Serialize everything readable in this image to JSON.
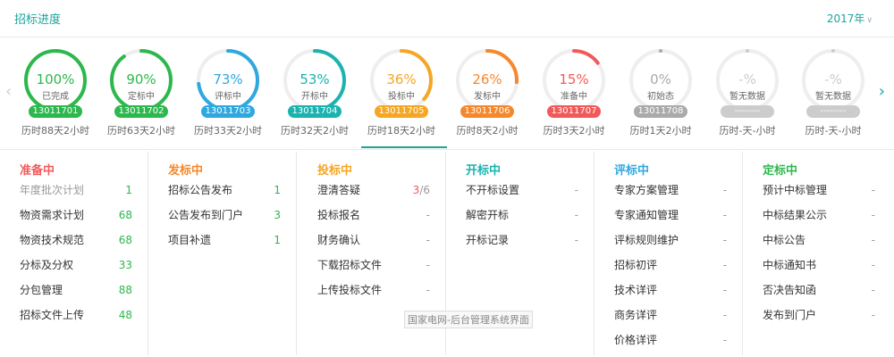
{
  "header": {
    "title": "招标进度",
    "year": "2017年"
  },
  "stages": [
    {
      "pct": "100%",
      "fraction": 1.0,
      "state": "已完成",
      "code": "13011701",
      "duration": "历时88天2小时",
      "color": "#2db84d"
    },
    {
      "pct": "90%",
      "fraction": 0.9,
      "state": "定标中",
      "code": "13011702",
      "duration": "历时63天2小时",
      "color": "#2db84d"
    },
    {
      "pct": "73%",
      "fraction": 0.73,
      "state": "评标中",
      "code": "13011703",
      "duration": "历时33天2小时",
      "color": "#2fa8e0"
    },
    {
      "pct": "53%",
      "fraction": 0.53,
      "state": "开标中",
      "code": "13011704",
      "duration": "历时32天2小时",
      "color": "#1ab3b0"
    },
    {
      "pct": "36%",
      "fraction": 0.36,
      "state": "投标中",
      "code": "13011705",
      "duration": "历时18天2小时",
      "color": "#f5a623"
    },
    {
      "pct": "26%",
      "fraction": 0.26,
      "state": "发标中",
      "code": "13011706",
      "duration": "历时8天2小时",
      "color": "#f5882b"
    },
    {
      "pct": "15%",
      "fraction": 0.15,
      "state": "准备中",
      "code": "13011707",
      "duration": "历时3天2小时",
      "color": "#f25a5a"
    },
    {
      "pct": "0%",
      "fraction": 0.0,
      "state": "初始态",
      "code": "13011708",
      "duration": "历时1天2小时",
      "color": "#aaaaaa"
    },
    {
      "pct": "-%",
      "fraction": 0.0,
      "state": "暂无数据",
      "code": "--------",
      "duration": "历时-天-小时",
      "color": "#cccccc"
    },
    {
      "pct": "-%",
      "fraction": 0.0,
      "state": "暂无数据",
      "code": "--------",
      "duration": "历时-天-小时",
      "color": "#cccccc"
    }
  ],
  "panels": [
    {
      "title": "准备中",
      "color": "#f25a5a",
      "rows": [
        {
          "label": "年度批次计划",
          "value": "1",
          "dim": true
        },
        {
          "label": "物资需求计划",
          "value": "68"
        },
        {
          "label": "物资技术规范",
          "value": "68"
        },
        {
          "label": "分标及分权",
          "value": "33"
        },
        {
          "label": "分包管理",
          "value": "88"
        },
        {
          "label": "招标文件上传",
          "value": "48"
        }
      ]
    },
    {
      "title": "发标中",
      "color": "#f5882b",
      "rows": [
        {
          "label": "招标公告发布",
          "value": "1"
        },
        {
          "label": "公告发布到门户",
          "value": "3"
        },
        {
          "label": "项目补遗",
          "value": "1"
        }
      ]
    },
    {
      "title": "投标中",
      "color": "#f5a623",
      "rows": [
        {
          "label": "澄清答疑",
          "value": "3",
          "value2": "/6"
        },
        {
          "label": "投标报名",
          "value": "-"
        },
        {
          "label": "财务确认",
          "value": "-"
        },
        {
          "label": "下载招标文件",
          "value": "-"
        },
        {
          "label": "上传投标文件",
          "value": "-"
        }
      ]
    },
    {
      "title": "开标中",
      "color": "#1ab3b0",
      "rows": [
        {
          "label": "不开标设置",
          "value": "-"
        },
        {
          "label": "解密开标",
          "value": "-"
        },
        {
          "label": "开标记录",
          "value": "-"
        }
      ]
    },
    {
      "title": "评标中",
      "color": "#2fa8e0",
      "rows": [
        {
          "label": "专家方案管理",
          "value": "-"
        },
        {
          "label": "专家通知管理",
          "value": "-"
        },
        {
          "label": "评标规则维护",
          "value": "-"
        },
        {
          "label": "招标初评",
          "value": "-"
        },
        {
          "label": "技术详评",
          "value": "-"
        },
        {
          "label": "商务详评",
          "value": "-"
        },
        {
          "label": "价格详评",
          "value": "-"
        }
      ]
    },
    {
      "title": "定标中",
      "color": "#2db84d",
      "rows": [
        {
          "label": "预计中标管理",
          "value": "-"
        },
        {
          "label": "中标结果公示",
          "value": "-"
        },
        {
          "label": "中标公告",
          "value": "-"
        },
        {
          "label": "中标通知书",
          "value": "-"
        },
        {
          "label": "否决告知函",
          "value": "-"
        },
        {
          "label": "发布到门户",
          "value": "-"
        }
      ]
    }
  ],
  "watermark": "国家电网-后台管理系统界面"
}
